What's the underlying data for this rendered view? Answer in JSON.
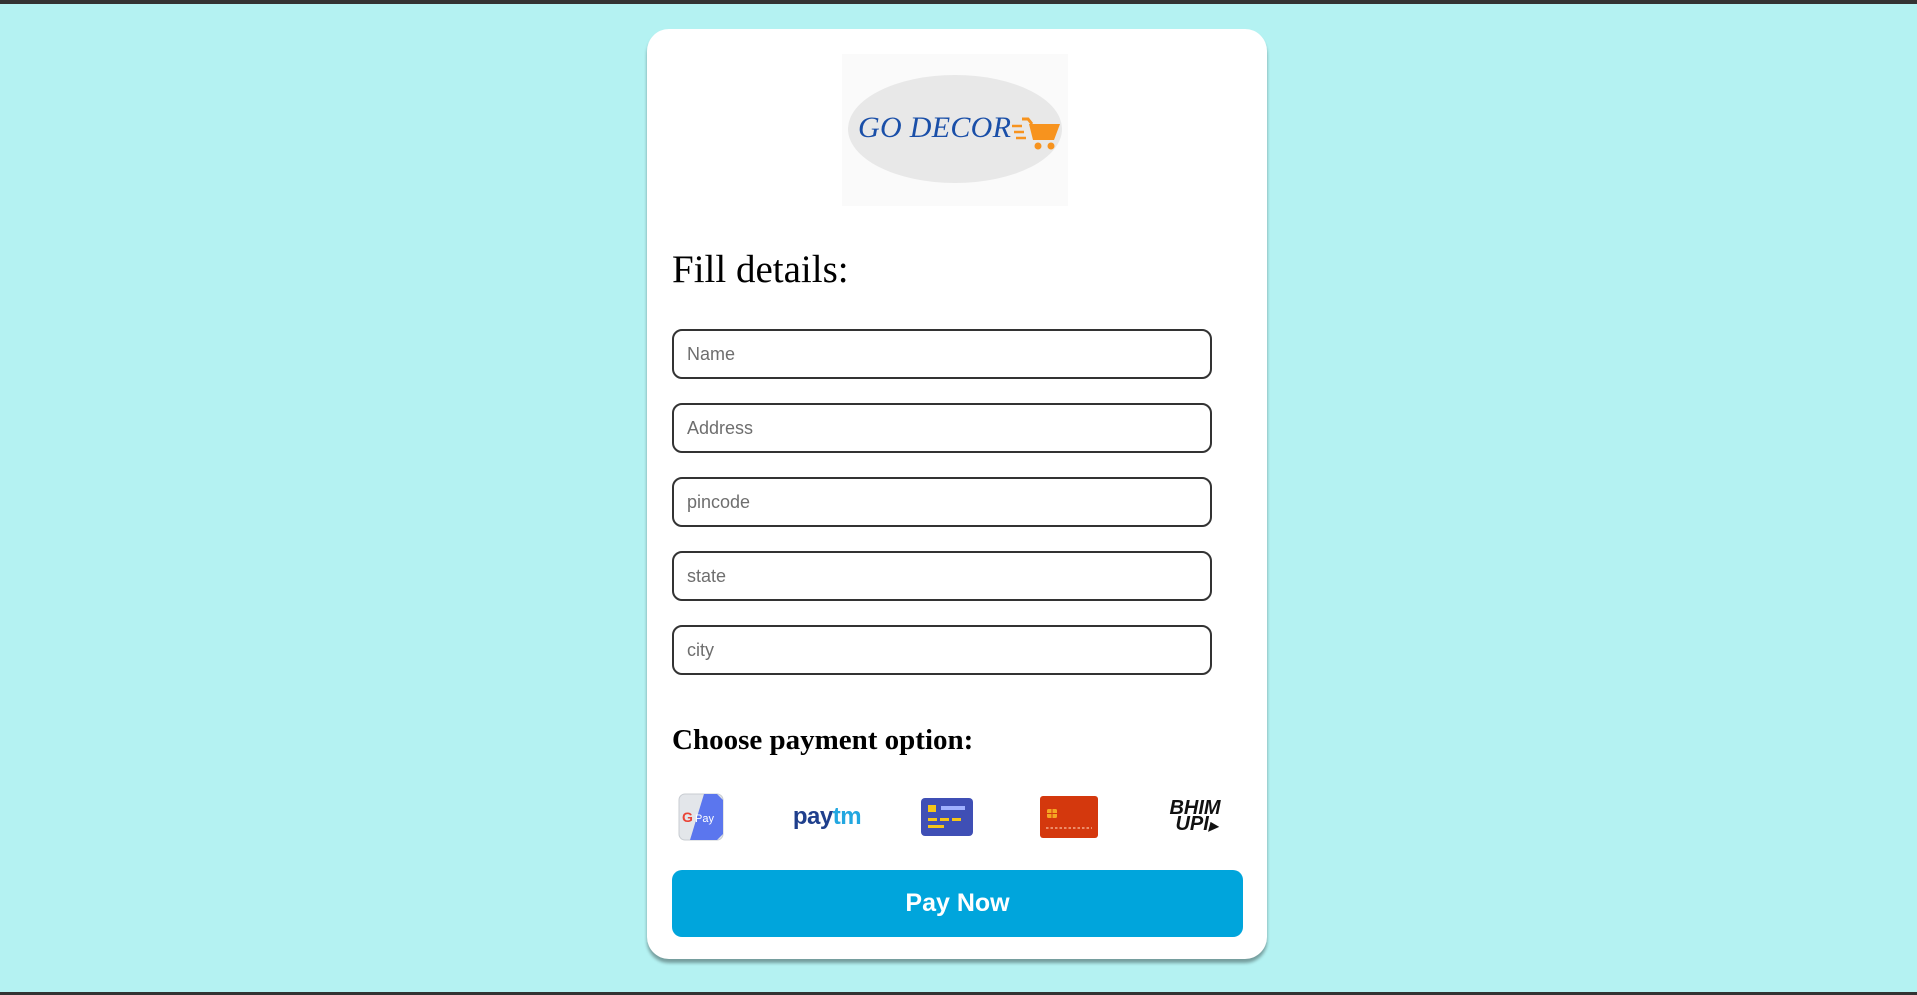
{
  "logo": {
    "text": "GO DECOR",
    "cart_icon": "shopping-cart-icon"
  },
  "form": {
    "heading": "Fill details:",
    "fields": [
      {
        "placeholder": "Name",
        "value": ""
      },
      {
        "placeholder": "Address",
        "value": ""
      },
      {
        "placeholder": "pincode",
        "value": ""
      },
      {
        "placeholder": "state",
        "value": ""
      },
      {
        "placeholder": "city",
        "value": ""
      }
    ]
  },
  "payment": {
    "heading": "Choose payment option:",
    "options": [
      {
        "icon": "google-pay-icon",
        "label": "Pay"
      },
      {
        "icon": "paytm-icon",
        "label_pay": "pay",
        "label_tm": "tm"
      },
      {
        "icon": "credit-card-icon"
      },
      {
        "icon": "debit-card-icon"
      },
      {
        "icon": "bhim-upi-icon",
        "line1": "BHIM",
        "line2": "UPI"
      }
    ],
    "button_label": "Pay Now"
  },
  "colors": {
    "background": "#b4f2f2",
    "card": "#ffffff",
    "brand_text": "#1a4fa8",
    "cart": "#f7931e",
    "button": "#00a5dc",
    "button_text": "#ffffff"
  }
}
